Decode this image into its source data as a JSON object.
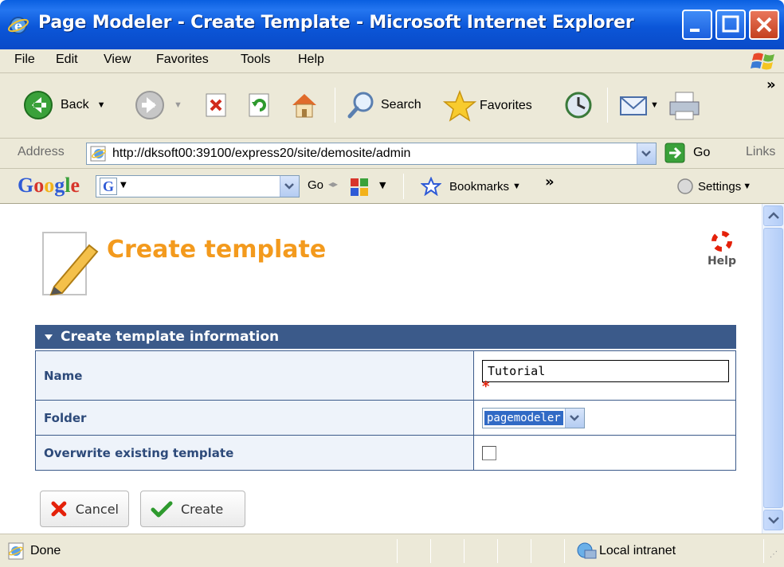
{
  "window": {
    "title": "Page Modeler - Create Template - Microsoft Internet Explorer"
  },
  "menu": {
    "items": [
      "File",
      "Edit",
      "View",
      "Favorites",
      "Tools",
      "Help"
    ]
  },
  "toolbar": {
    "back_label": "Back",
    "search_label": "Search",
    "favorites_label": "Favorites",
    "overflow": "»"
  },
  "address": {
    "label": "Address",
    "url": "http://dksoft00:39100/express20/site/demosite/admin",
    "go_label": "Go",
    "links_label": "Links"
  },
  "googlebar": {
    "logo": "Google",
    "go_label": "Go",
    "bookmarks_label": "Bookmarks",
    "overflow": "»",
    "settings_label": "Settings"
  },
  "page": {
    "title": "Create template",
    "help_label": "Help",
    "panel_title": "Create template information",
    "fields": {
      "name_label": "Name",
      "name_value": "Tutorial",
      "required_mark": "*",
      "folder_label": "Folder",
      "folder_value": "pagemodeler",
      "overwrite_label": "Overwrite existing template",
      "overwrite_checked": false
    },
    "buttons": {
      "cancel_label": "Cancel",
      "create_label": "Create"
    }
  },
  "status": {
    "text": "Done",
    "zone": "Local intranet"
  },
  "colors": {
    "title_orange": "#f39a1d",
    "panel_header": "#3b5a8a",
    "required_red": "#e4210a",
    "xp_blue": "#0b56d8"
  }
}
